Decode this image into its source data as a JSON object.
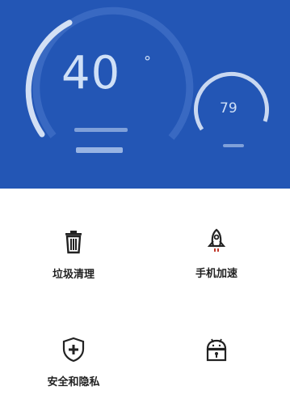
{
  "dashboard": {
    "main_gauge_value": "40",
    "main_gauge_unit": "°",
    "secondary_gauge_value": "79",
    "accent_color": "#2356b5"
  },
  "tiles": [
    {
      "label": "垃圾清理",
      "icon": "trash-icon"
    },
    {
      "label": "手机加速",
      "icon": "rocket-icon"
    },
    {
      "label": "安全和隐私",
      "icon": "shield-plus-icon"
    },
    {
      "label": "",
      "icon": "android-lock-icon"
    }
  ]
}
